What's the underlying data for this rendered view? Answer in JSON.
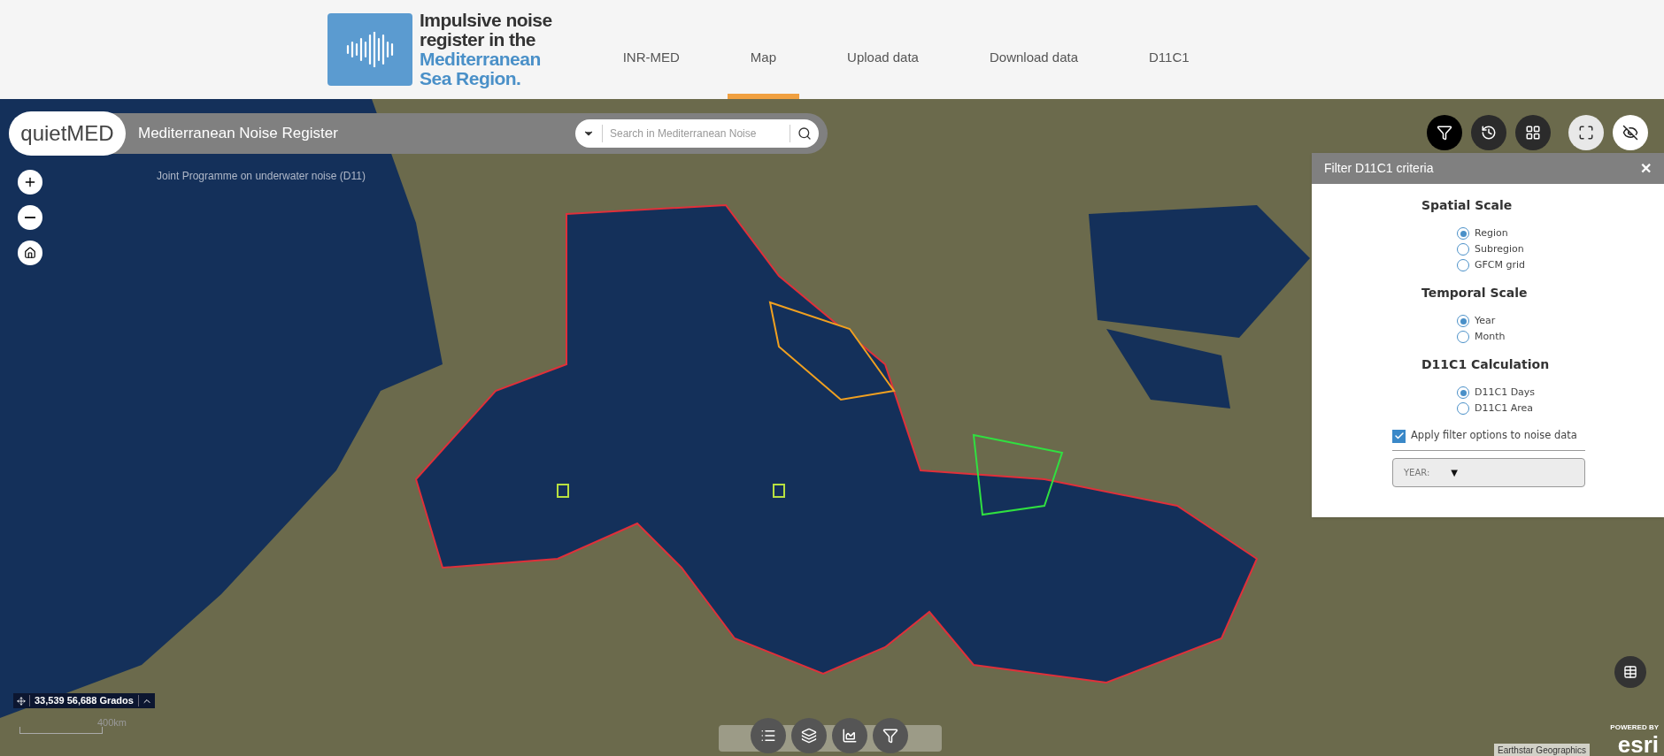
{
  "header": {
    "logo_lines": [
      {
        "text": "Impulsive noise",
        "kind": "dark"
      },
      {
        "text": "register in the",
        "kind": "dark"
      },
      {
        "text": "Mediterranean",
        "kind": "accent"
      },
      {
        "text": "Sea Region.",
        "kind": "accent"
      }
    ],
    "nav": [
      {
        "label": "INR-MED",
        "selected": false
      },
      {
        "label": "Map",
        "selected": true
      },
      {
        "label": "Upload data",
        "selected": false
      },
      {
        "label": "Download data",
        "selected": false
      },
      {
        "label": "D11C1",
        "selected": false
      }
    ]
  },
  "app_bar": {
    "brand": "quietMED",
    "title": "Mediterranean Noise Register",
    "search": {
      "placeholder": "Search in Mediterranean Noise"
    },
    "subtitle": "Joint Programme on underwater noise (D11)"
  },
  "map_tools": [
    {
      "kind": "filter",
      "selected": true
    },
    {
      "kind": "history",
      "selected": false
    },
    {
      "kind": "grid",
      "selected": false
    },
    {
      "kind": "fullscreen",
      "selected": false
    },
    {
      "kind": "hide",
      "selected": false
    }
  ],
  "filter_panel": {
    "title": "Filter D11C1 criteria",
    "close": "✕",
    "groups": [
      {
        "title": "Spatial Scale",
        "options": [
          {
            "label": "Region",
            "selected": true
          },
          {
            "label": "Subregion",
            "selected": false
          },
          {
            "label": "GFCM grid",
            "selected": false
          }
        ]
      },
      {
        "title": "Temporal Scale",
        "options": [
          {
            "label": "Year",
            "selected": true
          },
          {
            "label": "Month",
            "selected": false
          }
        ]
      },
      {
        "title": "D11C1 Calculation",
        "options": [
          {
            "label": "D11C1 Days",
            "selected": true
          },
          {
            "label": "D11C1 Area",
            "selected": false
          }
        ]
      }
    ],
    "apply": {
      "label": "Apply filter options to noise data",
      "checked": true
    },
    "year_select": {
      "label": "YEAR:",
      "caret": "▼"
    }
  },
  "coordinates": "33,539 56,688 Grados",
  "scale_bar": "400km",
  "attribution": "Earthstar Geographics",
  "powered": {
    "small": "POWERED BY",
    "logo": "esri"
  }
}
